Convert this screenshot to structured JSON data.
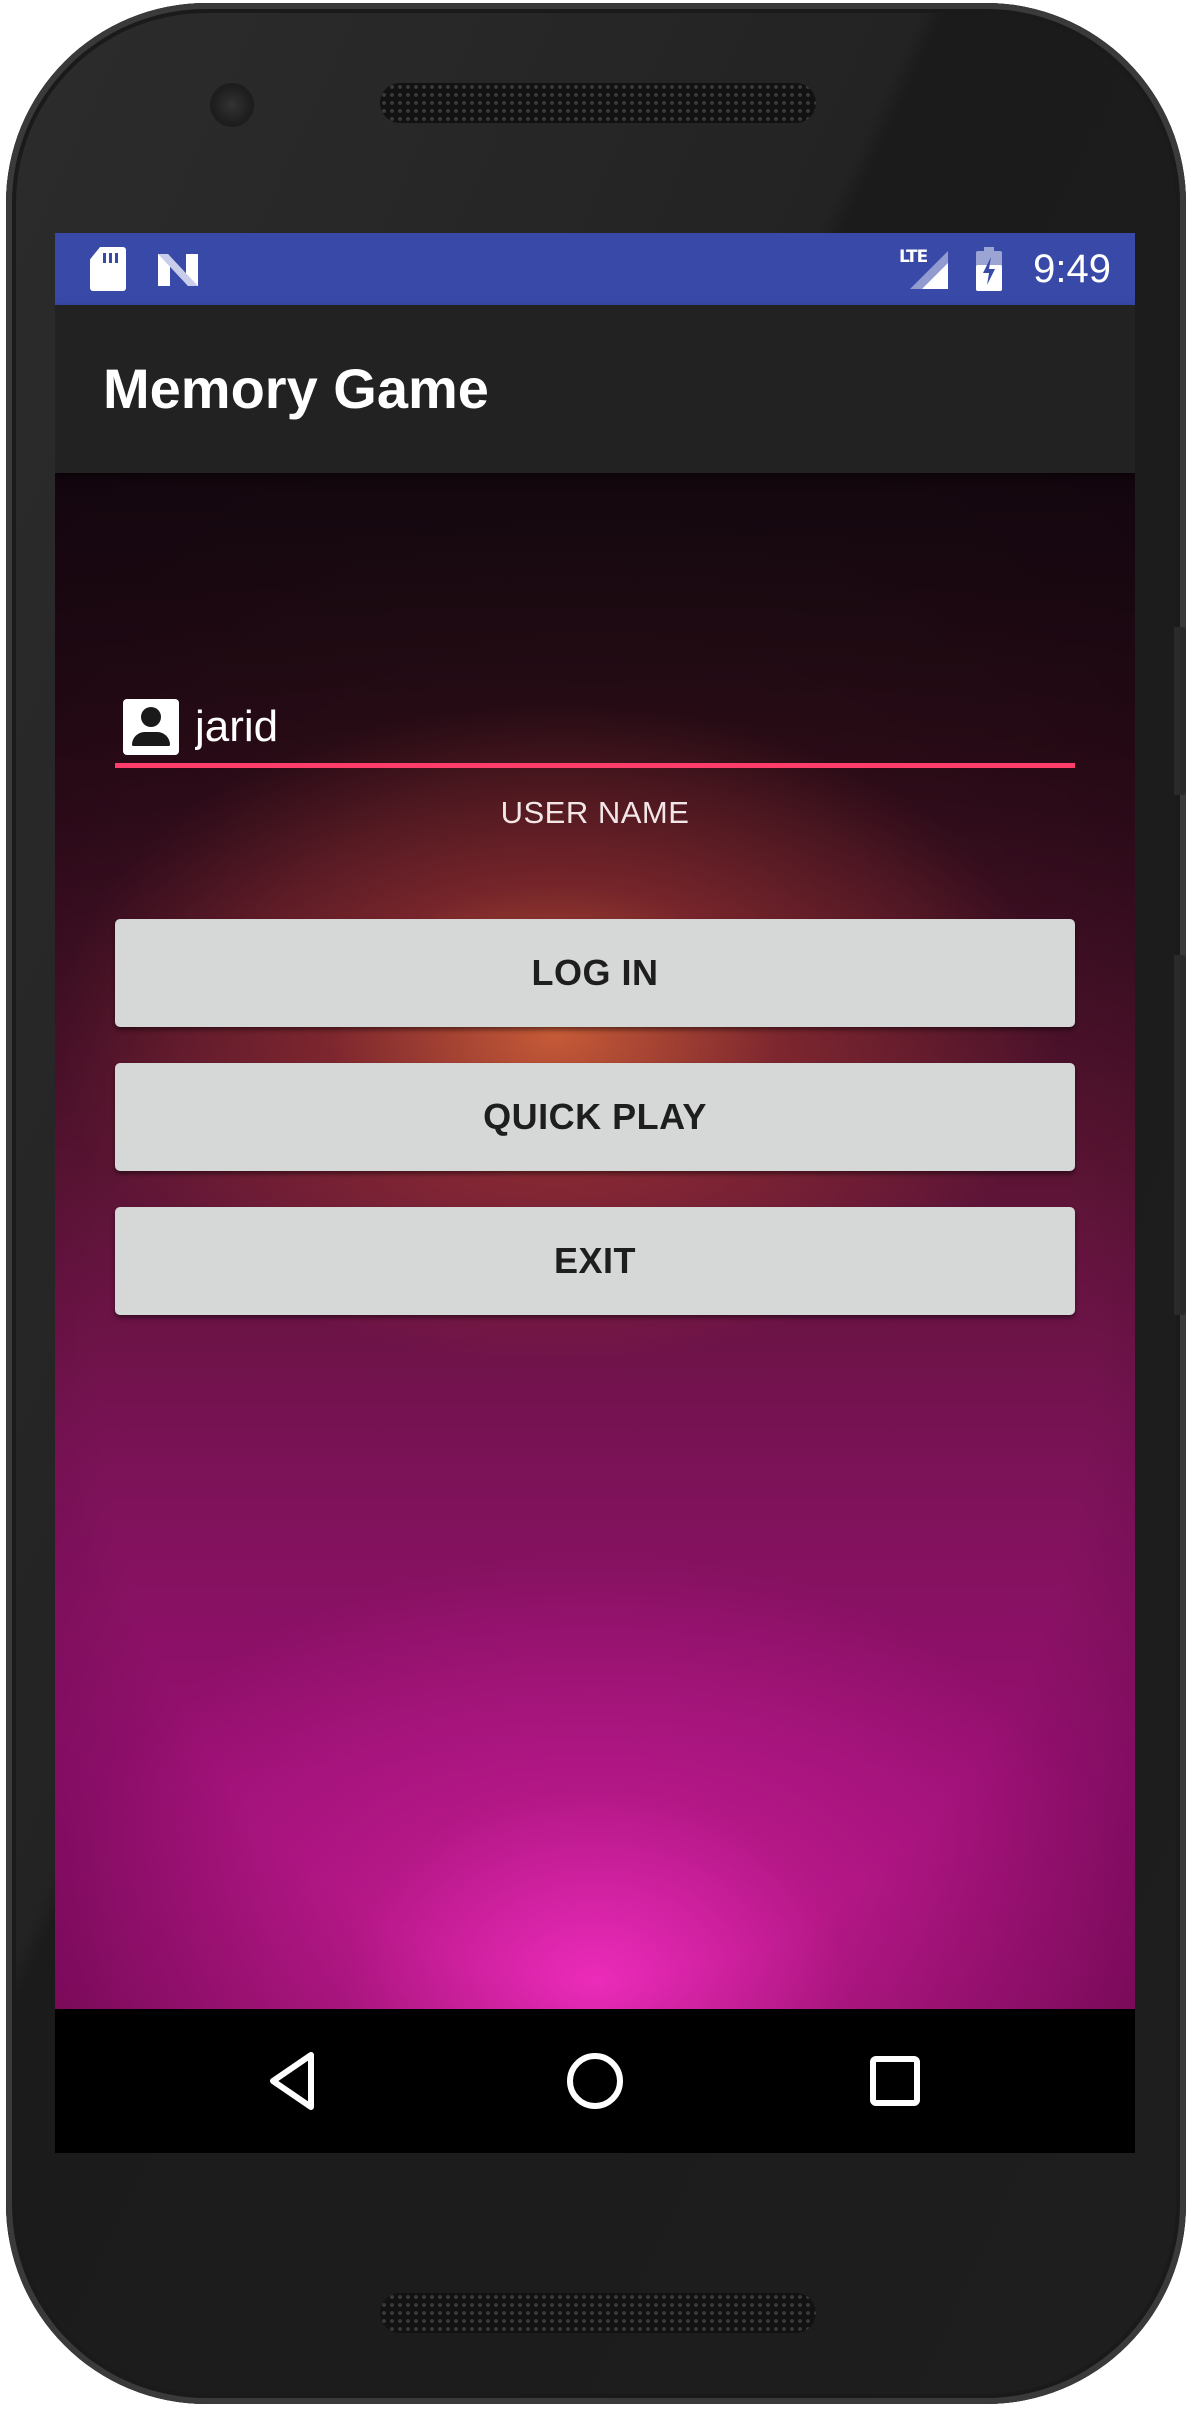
{
  "status_bar": {
    "time": "9:49",
    "network_label": "LTE",
    "icons": [
      "sd-card-icon",
      "n-notification-icon",
      "lte-signal-icon",
      "battery-icon"
    ]
  },
  "app_bar": {
    "title": "Memory Game"
  },
  "login_form": {
    "username_value": "jarid",
    "username_caption": "USER NAME",
    "accent_color": "#ff3d6a",
    "log_in_label": "LOG IN",
    "quick_play_label": "QUICK PLAY",
    "exit_label": "EXIT"
  },
  "nav_bar": {
    "icons": [
      "back-icon",
      "home-icon",
      "recents-icon"
    ]
  },
  "colors": {
    "status_bar": "#3949a8",
    "app_bar": "#222222",
    "button": "#d6d7d7"
  }
}
